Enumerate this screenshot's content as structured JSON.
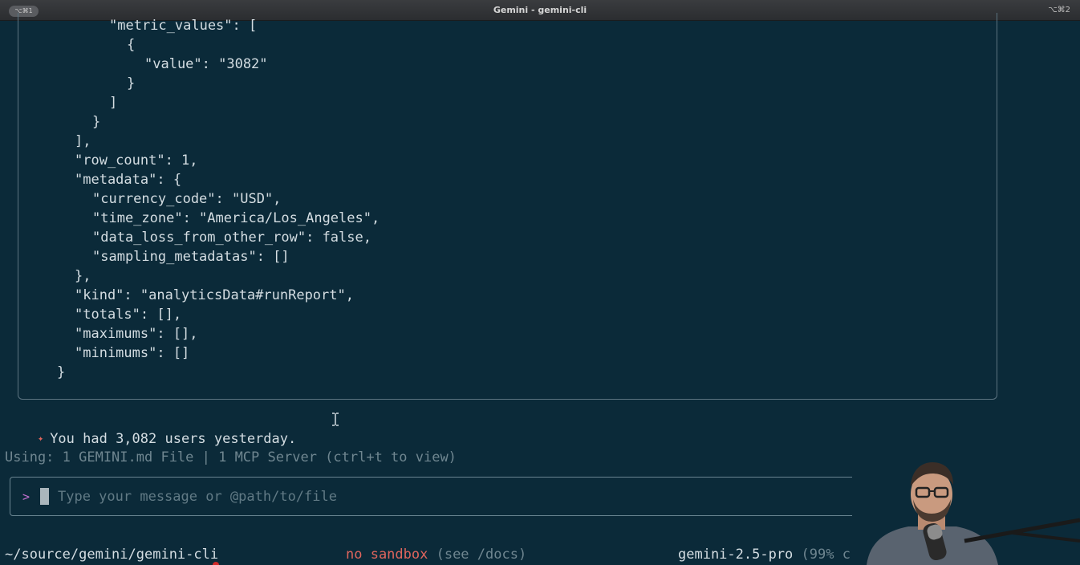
{
  "window": {
    "title": "Gemini - gemini-cli",
    "tab_pill": "⌥⌘1",
    "shortcut": "⌥⌘2"
  },
  "json_output": {
    "lines": [
      "\"metric_values\": [",
      "{",
      "\"value\": \"3082\"",
      "}",
      "]",
      "}",
      "],",
      "\"row_count\": 1,",
      "\"metadata\": {",
      "\"currency_code\": \"USD\",",
      "\"time_zone\": \"America/Los_Angeles\",",
      "\"data_loss_from_other_row\": false,",
      "\"sampling_metadatas\": []",
      "},",
      "\"kind\": \"analyticsData#runReport\",",
      "\"totals\": [],",
      "\"maximums\": [],",
      "\"minimums\": []",
      "}"
    ]
  },
  "response": {
    "icon": "sparkle-icon",
    "text": "You had 3,082 users yesterday."
  },
  "context_status": "Using: 1 GEMINI.md File | 1 MCP Server (ctrl+t to view)",
  "input": {
    "prompt_symbol": ">",
    "placeholder": "Type your message or @path/to/file"
  },
  "footer": {
    "path": "~/source/gemini/gemini-cli",
    "sandbox_warning": "no sandbox",
    "sandbox_hint": " (see /docs)",
    "model": "gemini-2.5-pro",
    "context_left": " (99% c"
  },
  "colors": {
    "background": "#0b2a39",
    "text": "#d4dde2",
    "muted": "#6f8690",
    "warning": "#e0655d",
    "prompt": "#c36fd0"
  }
}
